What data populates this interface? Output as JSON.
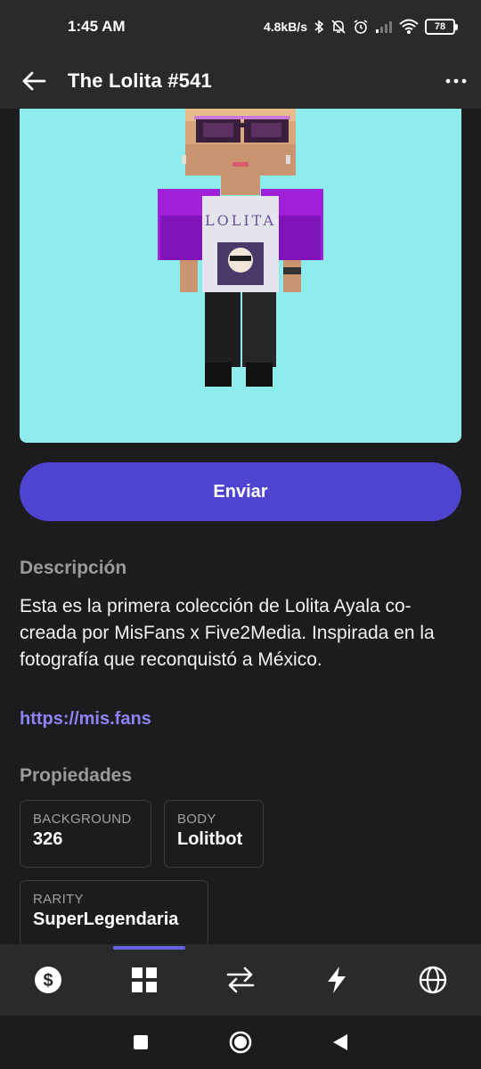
{
  "status_bar": {
    "time": "1:45 AM",
    "net_speed": "4.8kB/s",
    "battery": "78"
  },
  "app_bar": {
    "title": "The Lolita #541",
    "back_icon": "arrow-left-icon",
    "more_icon": "more-horizontal-icon"
  },
  "nft": {
    "shirt_text": "LOLITA",
    "background_color": "#8eecec"
  },
  "actions": {
    "send_label": "Enviar"
  },
  "description": {
    "title": "Descripción",
    "text": "Esta es la primera colección de Lolita Ayala co-creada por MisFans x Five2Media. Inspirada en la fotografía que reconquistó a México.",
    "link": "https://mis.fans"
  },
  "properties": {
    "title": "Propiedades",
    "items": [
      {
        "key": "BACKGROUND",
        "value": "326"
      },
      {
        "key": "BODY",
        "value": "Lolitbot"
      },
      {
        "key": "RARITY",
        "value": "SuperLegendaria"
      }
    ]
  },
  "bottom_nav": {
    "items": [
      "dollar-icon",
      "grid-icon",
      "swap-icon",
      "lightning-icon",
      "globe-icon"
    ],
    "active_index": 1
  },
  "system_nav": [
    "recents-icon",
    "home-icon",
    "back-icon"
  ],
  "colors": {
    "accent": "#4f44cf",
    "link": "#8b84f5",
    "surface": "#2a2a2b",
    "background": "#1c1c1e"
  }
}
